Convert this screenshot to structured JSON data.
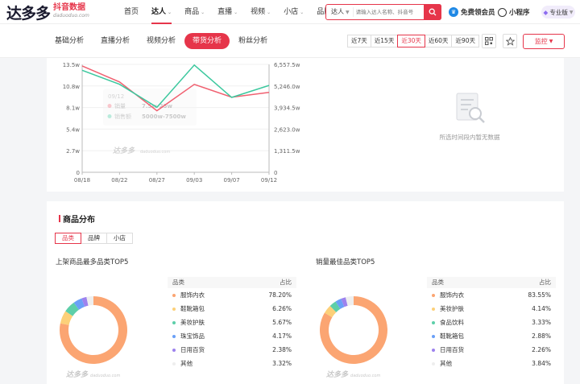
{
  "header": {
    "logo_text": "达多多",
    "logo_cn": "抖音数据",
    "logo_en": "daduoduo.com",
    "nav": [
      {
        "label": "首页",
        "dropdown": false
      },
      {
        "label": "达人",
        "dropdown": true
      },
      {
        "label": "商品",
        "dropdown": true
      },
      {
        "label": "直播",
        "dropdown": true
      },
      {
        "label": "视频",
        "dropdown": true
      },
      {
        "label": "小店",
        "dropdown": true
      },
      {
        "label": "品牌",
        "dropdown": true
      }
    ],
    "active_nav": "达人",
    "search_type": "达人",
    "search_placeholder": "请输入达人名称、抖音号",
    "vip_label": "免费领会员",
    "mini_label": "小程序",
    "pro_label": "专业版"
  },
  "subbar": {
    "tabs": [
      "基础分析",
      "直播分析",
      "视频分析",
      "带货分析",
      "粉丝分析"
    ],
    "active_tab": "带货分析",
    "periods": [
      "近7天",
      "近15天",
      "近30天",
      "近60天",
      "近90天"
    ],
    "active_period": "近30天",
    "monitor_label": "监控"
  },
  "chart_data": {
    "type": "line",
    "x": [
      "08/18",
      "08/22",
      "08/27",
      "09/03",
      "09/07",
      "09/12"
    ],
    "y_left_ticks": [
      "0",
      "2.7w",
      "5.4w",
      "8.1w",
      "10.8w",
      "13.5w"
    ],
    "y_right_ticks": [
      "0",
      "1,311.5w",
      "2,623.0w",
      "3,934.5w",
      "5,246.0w",
      "6,557.5w"
    ],
    "y_left_range": [
      0,
      13.5
    ],
    "y_right_range": [
      0,
      6557.5
    ],
    "series": [
      {
        "color": "#f06070",
        "axis": "left",
        "values": [
          13.3,
          11.3,
          7.7,
          11.0,
          9.4,
          10.0
        ]
      },
      {
        "color": "#3cc89e",
        "axis": "right",
        "values": [
          6200,
          5350,
          3950,
          6520,
          4550,
          5280
        ]
      }
    ],
    "tooltip": {
      "date": "09/12",
      "rows": [
        {
          "label": "销量",
          "value": "7.5w-25w"
        },
        {
          "label": "销售额",
          "value": "5000w-7500w"
        }
      ]
    },
    "grid": true
  },
  "empty_message": "所选时间段内暂无数据",
  "watermark": {
    "text": "达多多",
    "sub": "daduoduo.com"
  },
  "product_section": {
    "title": "商品分布",
    "segments": [
      "品类",
      "品牌",
      "小店"
    ],
    "active_segment": "品类",
    "left": {
      "subtitle": "上架商品最多品类TOP5",
      "col_category": "品类",
      "col_share": "占比",
      "rows": [
        {
          "name": "服饰内衣",
          "share": "78.20%",
          "value": 78.2,
          "color": "#fba572"
        },
        {
          "name": "鞋靴箱包",
          "share": "6.26%",
          "value": 6.26,
          "color": "#fcd079"
        },
        {
          "name": "美妆护肤",
          "share": "5.67%",
          "value": 5.67,
          "color": "#5dcfa9"
        },
        {
          "name": "珠宝饰品",
          "share": "4.17%",
          "value": 4.17,
          "color": "#6aa0f7"
        },
        {
          "name": "日用百货",
          "share": "2.38%",
          "value": 2.38,
          "color": "#9d82ee"
        },
        {
          "name": "其他",
          "share": "3.32%",
          "value": 3.32,
          "color": "#eeeeee"
        }
      ]
    },
    "right": {
      "subtitle": "销量最佳品类TOP5",
      "col_category": "品类",
      "col_share": "占比",
      "rows": [
        {
          "name": "服饰内衣",
          "share": "83.55%",
          "value": 83.55,
          "color": "#fba572"
        },
        {
          "name": "美妆护肤",
          "share": "4.14%",
          "value": 4.14,
          "color": "#fcd079"
        },
        {
          "name": "食品饮料",
          "share": "3.33%",
          "value": 3.33,
          "color": "#5dcfa9"
        },
        {
          "name": "鞋靴箱包",
          "share": "2.88%",
          "value": 2.88,
          "color": "#6aa0f7"
        },
        {
          "name": "日用百货",
          "share": "2.26%",
          "value": 2.26,
          "color": "#9d82ee"
        },
        {
          "name": "其他",
          "share": "3.84%",
          "value": 3.84,
          "color": "#eeeeee"
        }
      ]
    }
  }
}
